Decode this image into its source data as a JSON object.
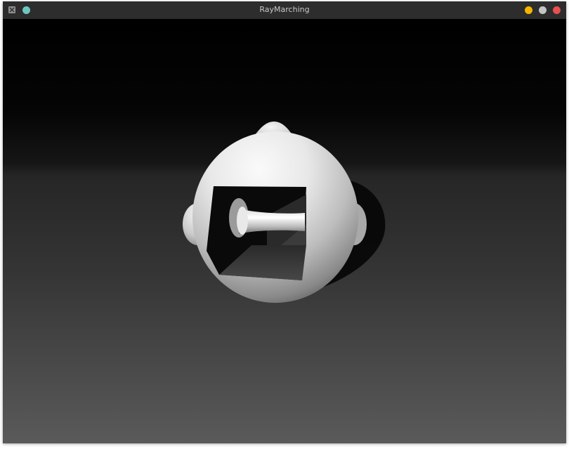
{
  "window": {
    "title": "RayMarching"
  },
  "titlebar": {
    "app_icon": "x11-app-icon",
    "pin_button": {
      "icon": "pin-icon",
      "color": "#6dc7bd"
    },
    "minimize_button": {
      "icon": "minimize-icon",
      "color": "#f7b500"
    },
    "maximize_button": {
      "icon": "maximize-icon",
      "color": "#c4c4c4"
    },
    "close_button": {
      "icon": "close-icon",
      "color": "#e94f4f"
    }
  },
  "scene": {
    "colors": {
      "sky_top": "#000000",
      "horizon": "#1e1e1e",
      "floor_far": "#2e2e2e",
      "floor_near": "#585858",
      "object_light": "#f2f2f2",
      "object_shadow": "#3a3a3a"
    }
  }
}
